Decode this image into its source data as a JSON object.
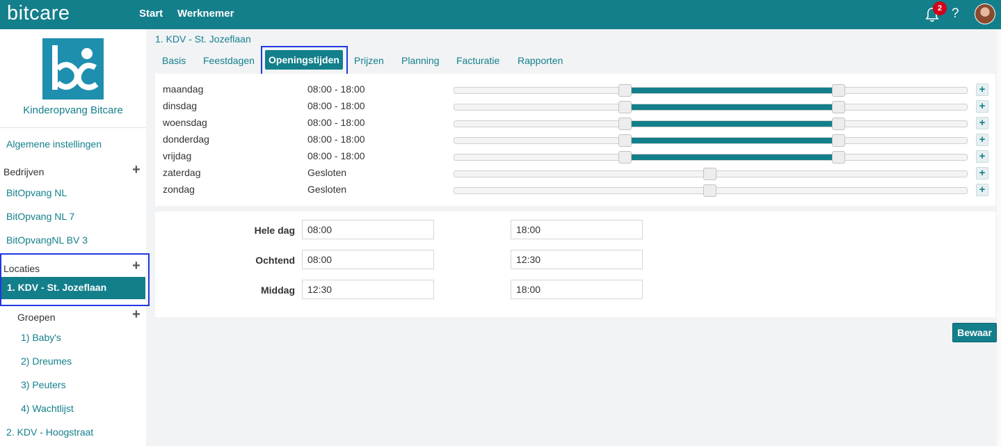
{
  "topbar": {
    "logo": "bitcare",
    "nav": [
      "Start",
      "Werknemer"
    ],
    "notification_count": "2",
    "help": "?"
  },
  "sidebar": {
    "brand_name": "Kinderopvang Bitcare",
    "general_settings": "Algemene instellingen",
    "companies_heading": "Bedrijven",
    "companies": [
      "BitOpvang NL",
      "BitOpvang NL 7",
      "BitOpvangNL BV 3"
    ],
    "locations_heading": "Locaties",
    "active_location": "1. KDV - St. Jozeflaan",
    "groups_heading": "Groepen",
    "groups": [
      "1) Baby's",
      "2) Dreumes",
      "3) Peuters",
      "4) Wachtlijst"
    ],
    "other_location": "2. KDV - Hoogstraat"
  },
  "main": {
    "breadcrumb": "1. KDV - St. Jozeflaan",
    "tabs": [
      "Basis",
      "Feestdagen",
      "Openingstijden",
      "Prijzen",
      "Planning",
      "Facturatie",
      "Rapporten"
    ],
    "active_tab": "Openingstijden",
    "days": [
      {
        "name": "maandag",
        "time": "08:00 - 18:00",
        "open": true,
        "start": 8,
        "end": 18
      },
      {
        "name": "dinsdag",
        "time": "08:00 - 18:00",
        "open": true,
        "start": 8,
        "end": 18
      },
      {
        "name": "woensdag",
        "time": "08:00 - 18:00",
        "open": true,
        "start": 8,
        "end": 18
      },
      {
        "name": "donderdag",
        "time": "08:00 - 18:00",
        "open": true,
        "start": 8,
        "end": 18
      },
      {
        "name": "vrijdag",
        "time": "08:00 - 18:00",
        "open": true,
        "start": 8,
        "end": 18
      },
      {
        "name": "zaterdag",
        "time": "Gesloten",
        "open": false
      },
      {
        "name": "zondag",
        "time": "Gesloten",
        "open": false
      }
    ],
    "periods": [
      {
        "label": "Hele dag",
        "from": "08:00",
        "to": "18:00"
      },
      {
        "label": "Ochtend",
        "from": "08:00",
        "to": "12:30"
      },
      {
        "label": "Middag",
        "from": "12:30",
        "to": "18:00"
      }
    ],
    "save_label": "Bewaar"
  },
  "colors": {
    "primary": "#137f8b",
    "highlight_outline": "#1f38e0",
    "badge": "#d0021b"
  }
}
